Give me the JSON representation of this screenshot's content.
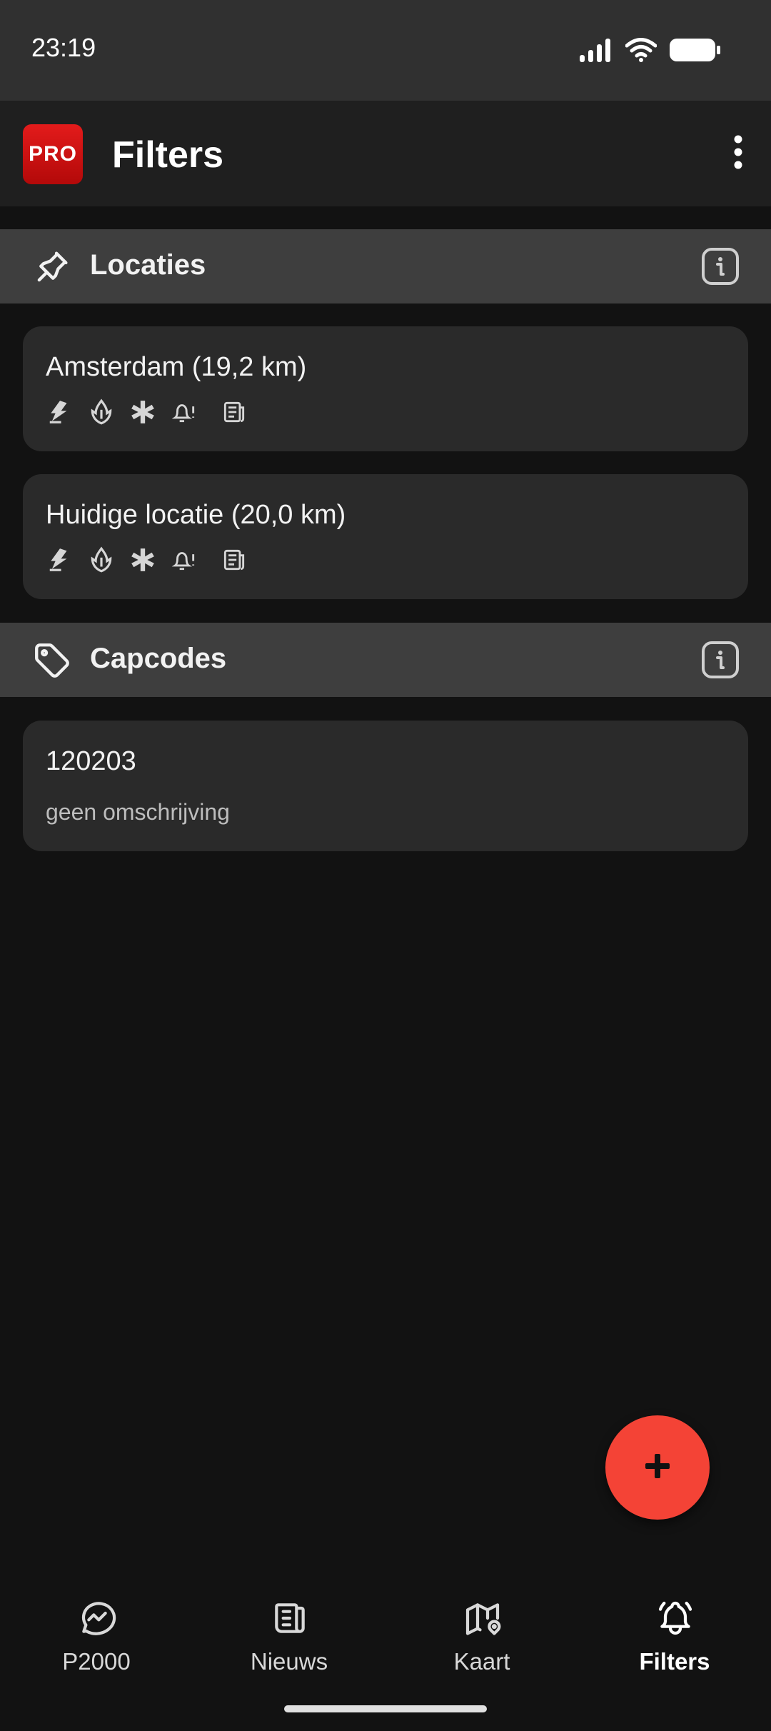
{
  "status_bar": {
    "time": "23:19",
    "icons": [
      "signal-icon",
      "wifi-icon",
      "battery-icon"
    ]
  },
  "app_bar": {
    "logo_text": "PRO",
    "title": "Filters",
    "menu_icon": "more-vertical-icon"
  },
  "sections": {
    "locaties": {
      "title": "Locaties",
      "icon": "pin-icon",
      "info_icon": "info-icon",
      "cards": [
        {
          "title": "Amsterdam (19,2 km)",
          "icons": [
            "police-icon",
            "fire-brigade-icon",
            "ambulance-icon",
            "alert-bell-icon",
            "news-icon"
          ]
        },
        {
          "title": "Huidige locatie (20,0 km)",
          "icons": [
            "police-icon",
            "fire-brigade-icon",
            "ambulance-icon",
            "alert-bell-icon",
            "news-icon"
          ]
        }
      ]
    },
    "capcodes": {
      "title": "Capcodes",
      "icon": "tag-icon",
      "info_icon": "info-icon",
      "cards": [
        {
          "code": "120203",
          "description": "geen omschrijving"
        }
      ]
    }
  },
  "fab": {
    "icon": "plus-icon"
  },
  "bottom_nav": {
    "items": [
      {
        "label": "P2000",
        "icon": "message-pulse-icon",
        "active": false
      },
      {
        "label": "Nieuws",
        "icon": "newspaper-icon",
        "active": false
      },
      {
        "label": "Kaart",
        "icon": "map-pin-icon",
        "active": false
      },
      {
        "label": "Filters",
        "icon": "bell-ringing-icon",
        "active": true
      }
    ]
  },
  "colors": {
    "background": "#121212",
    "accent": "#f44336",
    "section_header": "#3e3e3e",
    "card": "#2a2a2a",
    "logo": "#d11111"
  }
}
